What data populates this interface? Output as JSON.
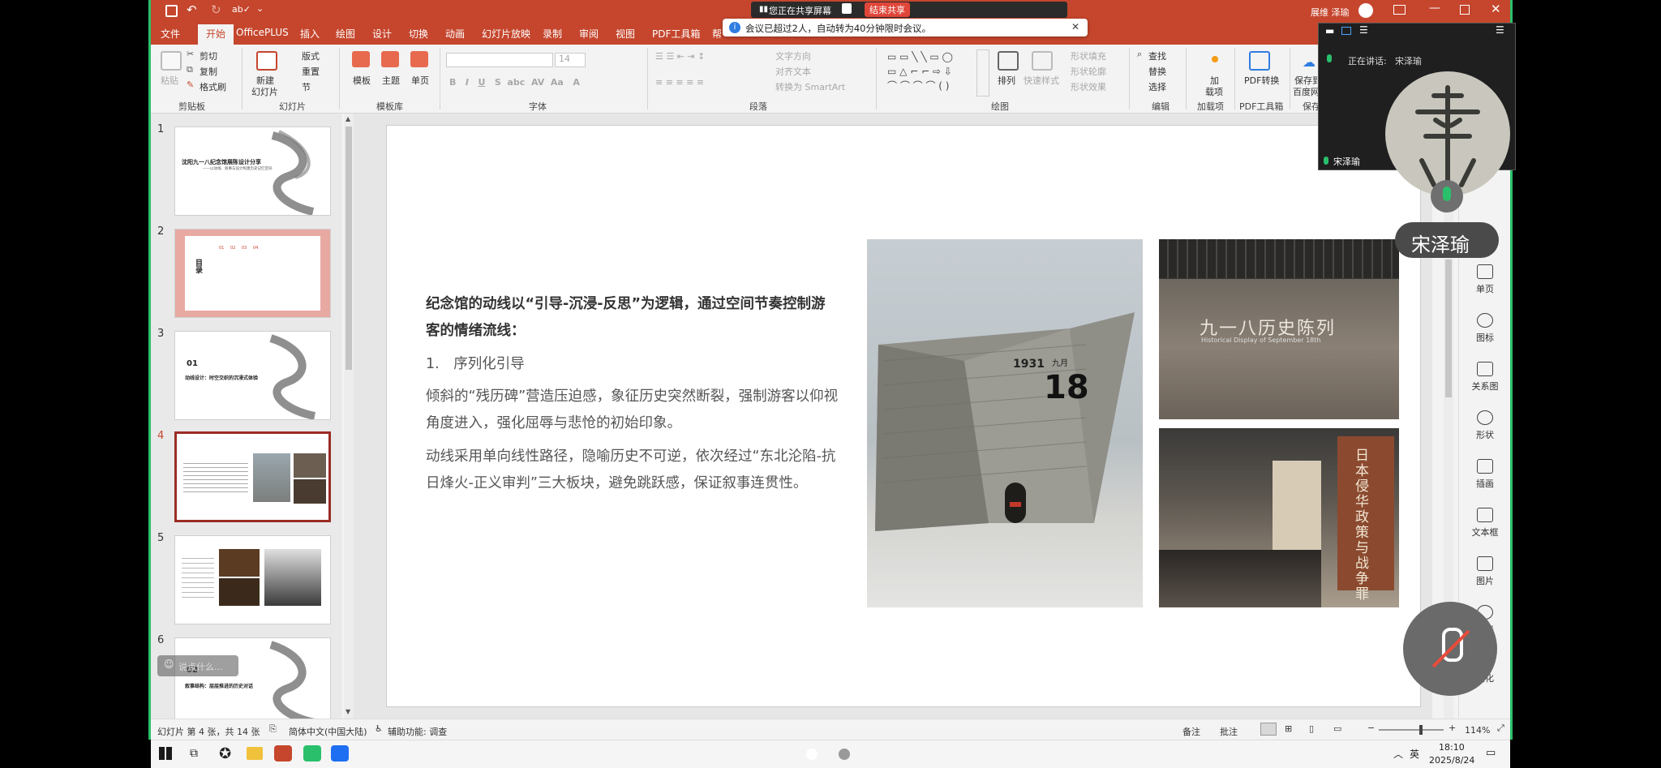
{
  "share_banner": {
    "text": "您正在共享屏幕",
    "end_label": "结束共享"
  },
  "notice": {
    "text": "会议已超过2人，自动转为40分钟限时会议。",
    "close": "✕"
  },
  "titlebar": {
    "user": "展维 泽瑜"
  },
  "tabs": [
    "文件",
    "开始",
    "OfficePLUS",
    "插入",
    "绘图",
    "设计",
    "切换",
    "动画",
    "幻灯片放映",
    "录制",
    "审阅",
    "视图",
    "PDF工具箱",
    "帮"
  ],
  "active_tab": "开始",
  "ribbon": {
    "clipboard": {
      "paste": "粘贴",
      "cut": "剪切",
      "copy": "复制",
      "format_painter": "格式刷",
      "label": "剪贴板"
    },
    "slides": {
      "new_slide": "新建",
      "new_slide2": "幻灯片",
      "layout": "版式",
      "reset": "重置",
      "section": "节",
      "label": "幻灯片"
    },
    "templates": {
      "template": "模板",
      "theme": "主题",
      "single": "单页",
      "label": "模板库"
    },
    "font": {
      "font_size": "14",
      "label": "字体"
    },
    "paragraph": {
      "text_direction": "文字方向",
      "align_text": "对齐文本",
      "smartart": "转换为 SmartArt",
      "label": "段落"
    },
    "drawing": {
      "arrange": "排列",
      "quick_styles": "快速样式",
      "fill": "形状填充",
      "outline": "形状轮廓",
      "effects": "形状效果",
      "label": "绘图"
    },
    "editing": {
      "find": "查找",
      "replace": "替换",
      "select": "选择",
      "label": "编辑"
    },
    "addins": {
      "addin": "加",
      "addin2": "载项",
      "label": "加载项"
    },
    "pdf": {
      "convert": "PDF转换",
      "label": "PDF工具箱"
    },
    "save": {
      "save": "保存到",
      "save2": "百度网",
      "label": "保存"
    }
  },
  "thumbnails": [
    {
      "num": "1",
      "title": "沈阳九一八纪念馆展陈设计分享",
      "sub": "——以动线、叙事与设计构建历史记忆空间"
    },
    {
      "num": "2",
      "title": "目录",
      "items": [
        "01",
        "02",
        "03",
        "04"
      ]
    },
    {
      "num": "3",
      "title": "01",
      "sub": "动线设计：时空交织的沉浸式体验"
    },
    {
      "num": "4"
    },
    {
      "num": "5"
    },
    {
      "num": "6",
      "title": "02",
      "sub": "叙事结构：层层推进的历史对话"
    }
  ],
  "search_hint": "说点什么...",
  "slide": {
    "heading": "纪念馆的动线以“引导-沉浸-反思”为逻辑，通过空间节奏控制游客的情绪流线：",
    "item1": "1. 序列化引导",
    "p1": "倾斜的“残历碑”营造压迫感，象征历史突然断裂，强制游客以仰视角度进入，强化屈辱与悲怆的初始印象。",
    "p2": "动线采用单向线性路径，隐喻历史不可逆，依次经过“东北沦陷-抗日烽火-正义审判”三大板块，避免跳跃感，保证叙事连贯性。",
    "photo1": {
      "year": "1931",
      "big": "18",
      "small": "九月"
    },
    "photo2": {
      "title": "九一八历史陈列",
      "sub": "Historical Display of September 18th"
    },
    "photo3": {
      "title": "日本侵华政策与战争罪"
    }
  },
  "right_sidebar": [
    "单页",
    "图标",
    "关系图",
    "形状",
    "插画",
    "文本框",
    "图片",
    "图表",
    "美化"
  ],
  "meeting": {
    "speaking_label": "正在讲话:",
    "speaking_name": "宋泽瑜",
    "tile_name": "宋泽瑜",
    "big_name": "宋泽瑜"
  },
  "status": {
    "slide_info": "幻灯片 第 4 张，共 14 张",
    "language": "简体中文(中国大陆)",
    "accessibility": "辅助功能: 调查",
    "notes": "备注",
    "comments": "批注",
    "zoom": "114%"
  },
  "taskbar": {
    "lang": "英",
    "time": "18:10",
    "date": "2025/8/24"
  },
  "colors": {
    "accent": "#c5462d",
    "selected_border": "#9b2c26",
    "meeting_green": "#2ac06b"
  }
}
